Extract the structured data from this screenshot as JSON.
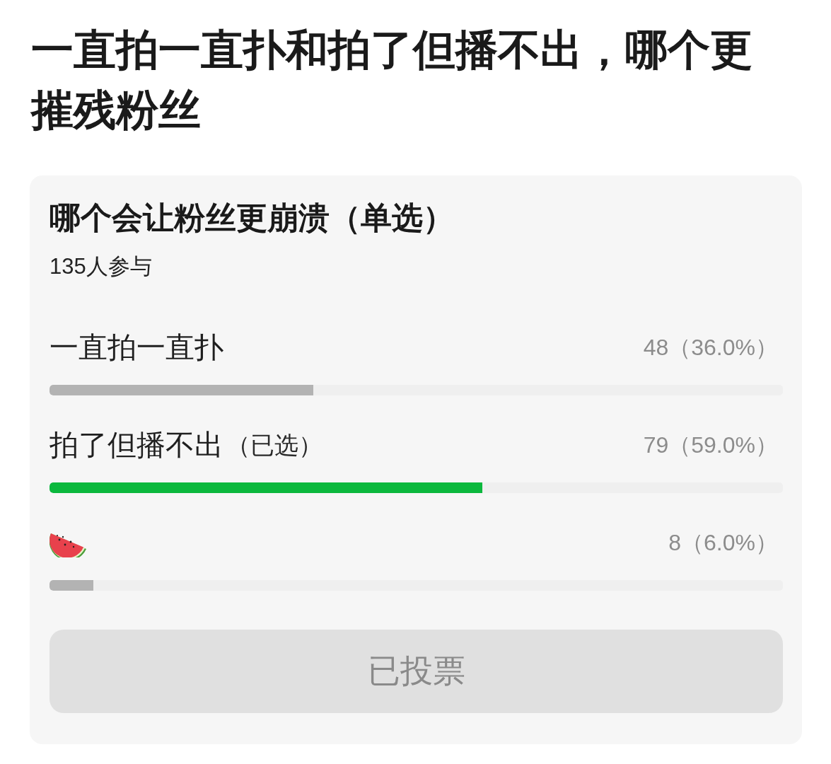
{
  "title": "一直拍一直扑和拍了但播不出，哪个更摧残粉丝",
  "poll": {
    "question": "哪个会让粉丝更崩溃（单选）",
    "participants": "135人参与",
    "options": [
      {
        "kind": "text",
        "label": "一直拍一直扑",
        "count": "48（36.0%）",
        "level": 0.36,
        "selected": false
      },
      {
        "kind": "text",
        "label": "拍了但播不出",
        "note": "（已选）",
        "count": "79（59.0%）",
        "level": 0.59,
        "selected": true
      },
      {
        "kind": "emoji",
        "count": "8（6.0%）",
        "level": 0.06,
        "selected": false
      }
    ],
    "vote_button": {
      "label": "已投票",
      "disabled": true
    }
  }
}
